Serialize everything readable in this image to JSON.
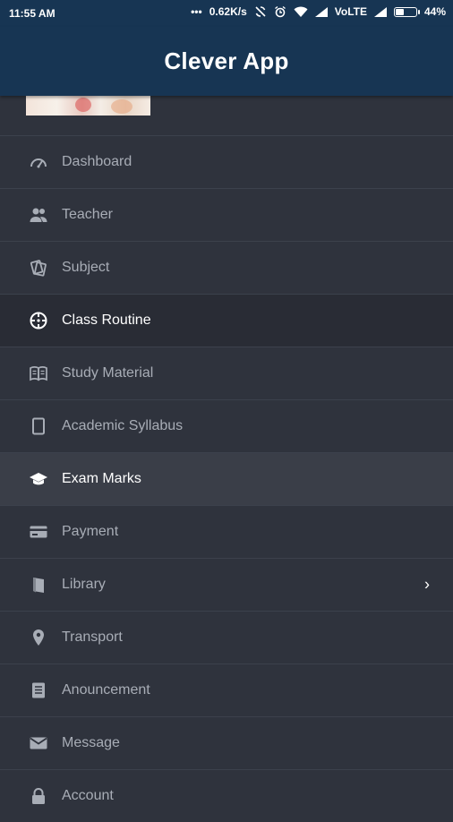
{
  "status_bar": {
    "time": "11:55 AM",
    "speed": "0.62K/s",
    "network": "VoLTE",
    "battery": "44%",
    "battery_level": 0.44
  },
  "app_bar": {
    "title": "Clever App"
  },
  "menu": {
    "items": [
      {
        "label": "Dashboard",
        "icon": "speedometer-icon"
      },
      {
        "label": "Teacher",
        "icon": "people-icon"
      },
      {
        "label": "Subject",
        "icon": "cards-icon"
      },
      {
        "label": "Class Routine",
        "icon": "compass-icon"
      },
      {
        "label": "Study Material",
        "icon": "book-icon"
      },
      {
        "label": "Academic Syllabus",
        "icon": "tablet-icon"
      },
      {
        "label": "Exam Marks",
        "icon": "graduation-cap-icon"
      },
      {
        "label": "Payment",
        "icon": "credit-card-icon"
      },
      {
        "label": "Library",
        "icon": "library-book-icon",
        "chevron": "›"
      },
      {
        "label": "Transport",
        "icon": "location-pin-icon"
      },
      {
        "label": "Anouncement",
        "icon": "document-icon"
      },
      {
        "label": "Message",
        "icon": "mail-icon"
      },
      {
        "label": "Account",
        "icon": "lock-icon"
      }
    ]
  }
}
